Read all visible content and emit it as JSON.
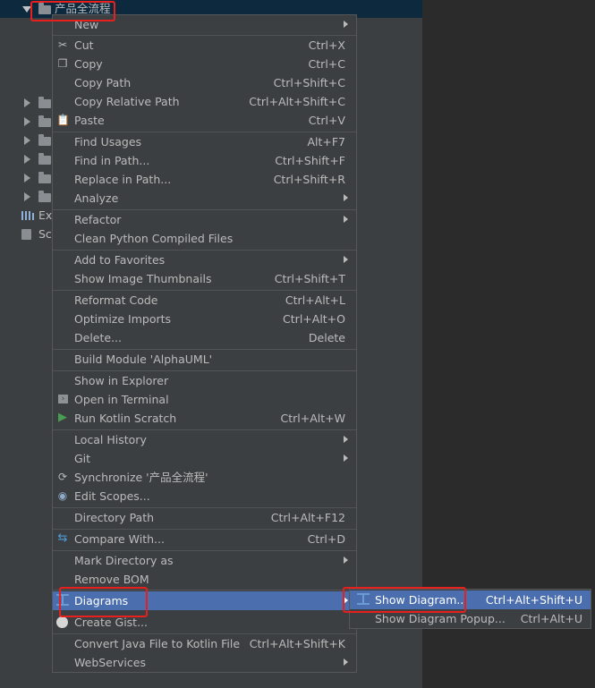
{
  "project_tree": {
    "selected_folder": "产品全流程",
    "ext_label": "Ext",
    "scr_label": "Scr"
  },
  "context_menu": {
    "items": [
      {
        "label": "New",
        "shortcut": "",
        "submenu": true
      },
      {
        "label": "Cut",
        "shortcut": "Ctrl+X",
        "icon": "scissors-icon"
      },
      {
        "label": "Copy",
        "shortcut": "Ctrl+C",
        "icon": "copy-icon"
      },
      {
        "label": "Copy Path",
        "shortcut": "Ctrl+Shift+C"
      },
      {
        "label": "Copy Relative Path",
        "shortcut": "Ctrl+Alt+Shift+C"
      },
      {
        "label": "Paste",
        "shortcut": "Ctrl+V",
        "icon": "clipboard-icon"
      },
      {
        "label": "Find Usages",
        "shortcut": "Alt+F7"
      },
      {
        "label": "Find in Path...",
        "shortcut": "Ctrl+Shift+F"
      },
      {
        "label": "Replace in Path...",
        "shortcut": "Ctrl+Shift+R"
      },
      {
        "label": "Analyze",
        "shortcut": "",
        "submenu": true
      },
      {
        "label": "Refactor",
        "shortcut": "",
        "submenu": true
      },
      {
        "label": "Clean Python Compiled Files",
        "shortcut": ""
      },
      {
        "label": "Add to Favorites",
        "shortcut": "",
        "submenu": true
      },
      {
        "label": "Show Image Thumbnails",
        "shortcut": "Ctrl+Shift+T"
      },
      {
        "label": "Reformat Code",
        "shortcut": "Ctrl+Alt+L"
      },
      {
        "label": "Optimize Imports",
        "shortcut": "Ctrl+Alt+O"
      },
      {
        "label": "Delete...",
        "shortcut": "Delete"
      },
      {
        "label": "Build Module 'AlphaUML'",
        "shortcut": ""
      },
      {
        "label": "Show in Explorer",
        "shortcut": ""
      },
      {
        "label": "Open in Terminal",
        "shortcut": "",
        "icon": "terminal-icon"
      },
      {
        "label": "Run Kotlin Scratch",
        "shortcut": "Ctrl+Alt+W",
        "icon": "run-icon"
      },
      {
        "label": "Local History",
        "shortcut": "",
        "submenu": true
      },
      {
        "label": "Git",
        "shortcut": "",
        "submenu": true
      },
      {
        "label": "Synchronize '产品全流程'",
        "shortcut": "",
        "icon": "sync-icon"
      },
      {
        "label": "Edit Scopes...",
        "shortcut": "",
        "icon": "scopes-icon"
      },
      {
        "label": "Directory Path",
        "shortcut": "Ctrl+Alt+F12"
      },
      {
        "label": "Compare With...",
        "shortcut": "Ctrl+D",
        "icon": "compare-icon"
      },
      {
        "label": "Mark Directory as",
        "shortcut": "",
        "submenu": true
      },
      {
        "label": "Remove BOM",
        "shortcut": ""
      },
      {
        "label": "Diagrams",
        "shortcut": "",
        "submenu": true,
        "icon": "diagram-icon",
        "selected": true
      },
      {
        "label": "Create Gist...",
        "shortcut": "",
        "icon": "github-icon"
      },
      {
        "label": "Convert Java File to Kotlin File",
        "shortcut": "Ctrl+Alt+Shift+K"
      },
      {
        "label": "WebServices",
        "shortcut": "",
        "submenu": true
      }
    ]
  },
  "diagrams_submenu": {
    "items": [
      {
        "label": "Show Diagram...",
        "shortcut": "Ctrl+Alt+Shift+U",
        "icon": "diagram-icon",
        "selected": true
      },
      {
        "label": "Show Diagram Popup...",
        "shortcut": "Ctrl+Alt+U"
      }
    ]
  },
  "colors": {
    "menu_bg": "#3c3f41",
    "selection": "#4b6eaf",
    "highlight_box": "#e8201d",
    "editor_bg": "#2b2b2b"
  }
}
